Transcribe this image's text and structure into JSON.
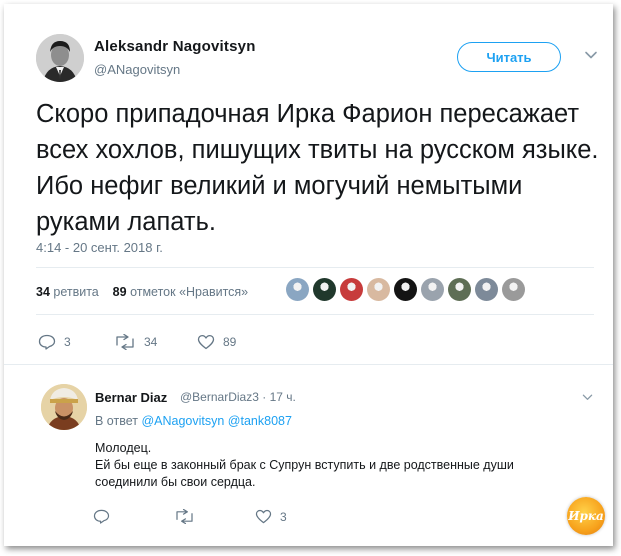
{
  "tweet": {
    "author_name": "Aleksandr Nagovitsyn",
    "author_handle": "@ANagovitsyn",
    "follow_label": "Читать",
    "text": "Скоро припадочная Ирка Фарион пересажает всех хохлов, пишущих твиты на русском языке. Ибо нефиг великий и могучий немытыми руками лапать.",
    "timestamp": "4:14 - 20 сент. 2018 г.",
    "retweets_count": "34",
    "retweets_label": "ретвита",
    "likes_count": "89",
    "likes_label": "отметок «Нравится»",
    "liker_avatar_colors": [
      "#8aa6c2",
      "#20382c",
      "#c73b3b",
      "#d8b9a0",
      "#141414",
      "#9aa3ad",
      "#5e6e55",
      "#7d8a99",
      "#9a9a9a"
    ],
    "actions": {
      "reply_count": "3",
      "retweet_count": "34",
      "like_count": "89"
    }
  },
  "reply": {
    "author_name": "Bernar Diaz",
    "author_handle": "@BernarDiaz3",
    "time": "· 17 ч.",
    "reply_to_prefix": "В ответ",
    "reply_to_users": "@ANagovitsyn @tank8087",
    "text_line1": "Молодец.",
    "text_line2": "Ей бы еще в законный брак с Супрун вступить и две родственные души соединили бы свои сердца.",
    "like_count": "3"
  },
  "watermark": "Ирка",
  "colors": {
    "accent": "#1da1f2",
    "muted": "#657786",
    "text": "#14171a",
    "divider": "#e6ecf0"
  }
}
